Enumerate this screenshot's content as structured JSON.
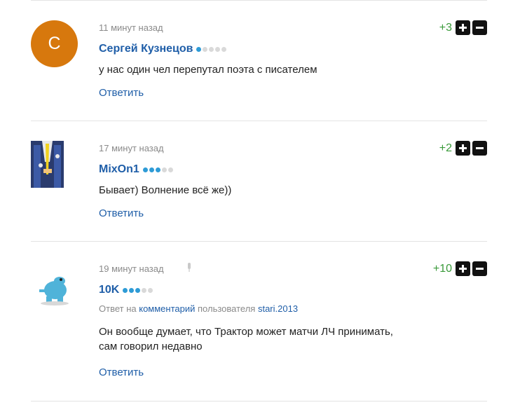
{
  "comments": [
    {
      "avatar_letter": "С",
      "time": "11 минут назад",
      "score": "+3",
      "author": "Сергей Кузнецов",
      "rating": 1,
      "text": "у нас один чел перепутал поэта с писателем",
      "reply": "Ответить"
    },
    {
      "time": "17 минут назад",
      "score": "+2",
      "author": "MixOn1",
      "rating": 3,
      "text": "Бывает) Волнение всё же))",
      "reply": "Ответить"
    },
    {
      "time": "19 минут назад",
      "score": "+10",
      "author": "10K",
      "rating": 3,
      "reply_prefix": "Ответ на",
      "reply_link": "комментарий",
      "reply_middle": "пользователя",
      "reply_user": "stari.2013",
      "text_line1": "Он вообще думает, что Трактор может матчи ЛЧ принимать,",
      "text_line2": "сам говорил недавно",
      "reply": "Ответить"
    }
  ]
}
